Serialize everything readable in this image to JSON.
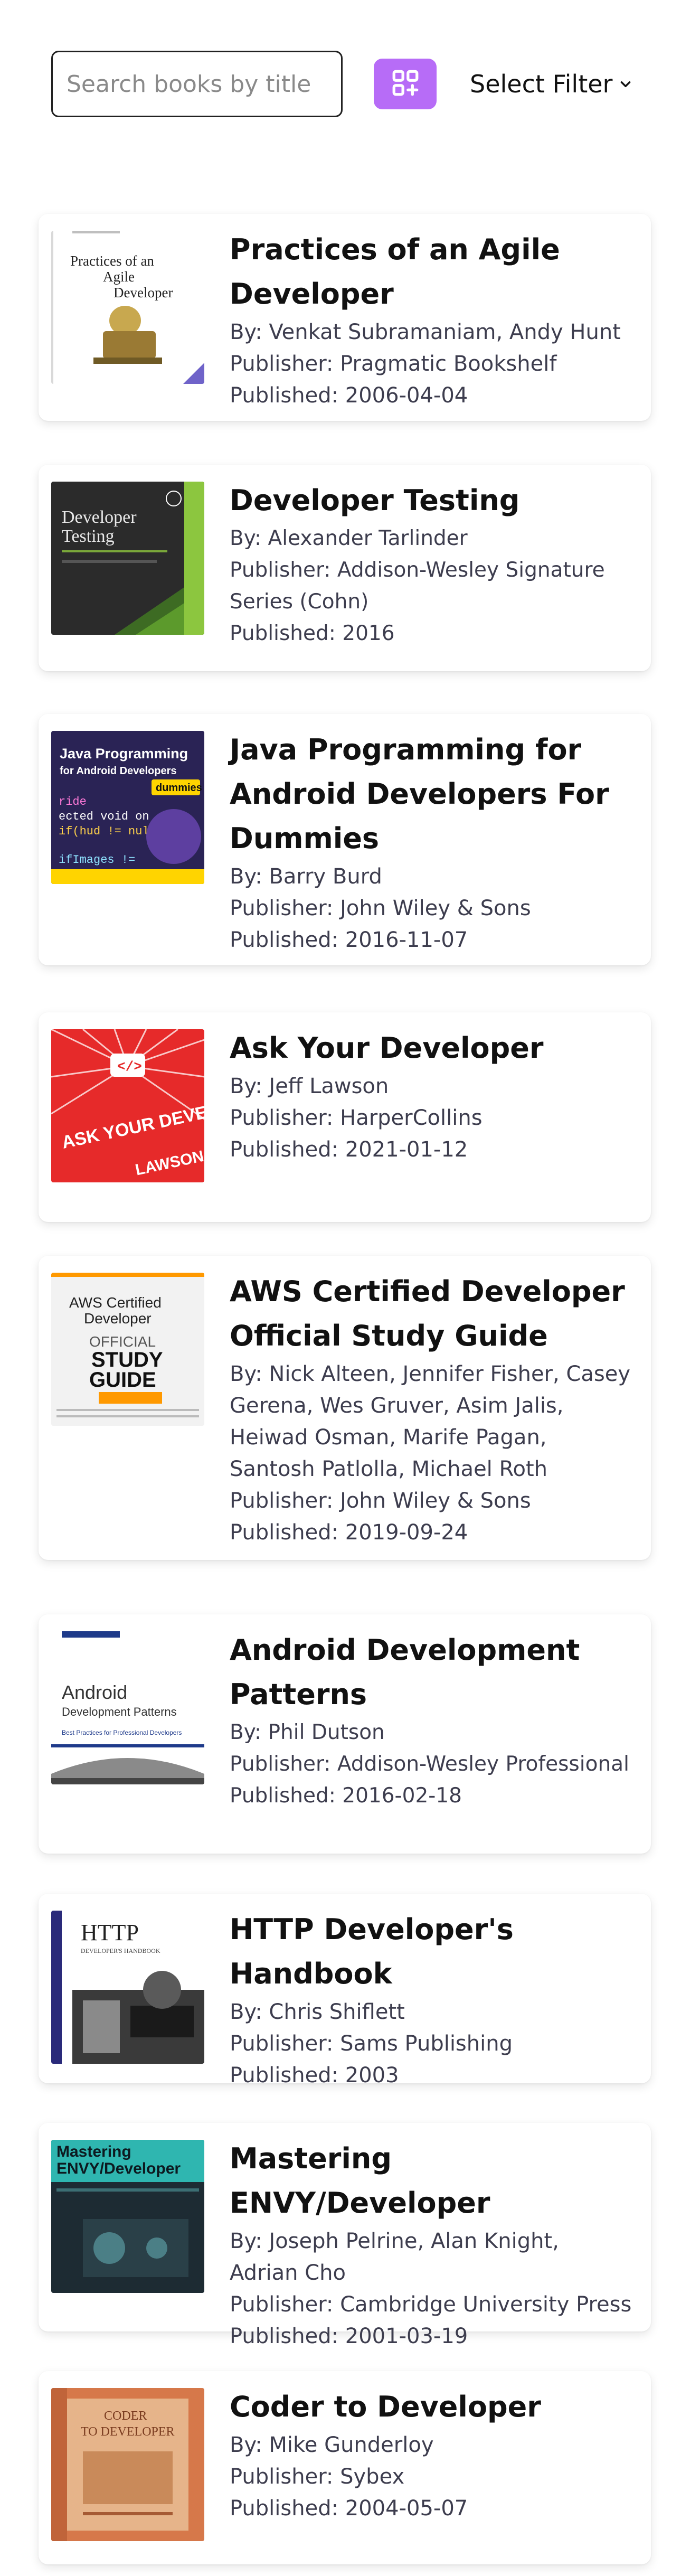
{
  "search": {
    "placeholder": "Search books by title",
    "value": ""
  },
  "toolbar": {
    "view_toggle_icon": "grid-add-icon",
    "filter_label": "Select Filter",
    "accent_color": "#b76cf7"
  },
  "books": [
    {
      "title": "Practices of an Agile Developer",
      "authors": "By: Venkat Subramaniam, Andy Hunt",
      "publisher": "Publisher: Pragmatic Bookshelf",
      "published": "Published: 2006-04-04",
      "cover": {
        "title_line1": "Practices of an",
        "title_line2": "Agile",
        "title_line3": "Developer"
      }
    },
    {
      "title": "Developer Testing",
      "authors": "By: Alexander Tarlinder",
      "publisher": "Publisher: Addison-Wesley Signature Series (Cohn)",
      "published": "Published: 2016",
      "cover": {
        "title_line1": "Developer",
        "title_line2": "Testing"
      }
    },
    {
      "title": "Java Programming for Android Developers For Dummies",
      "authors": "By: Barry Burd",
      "publisher": "Publisher: John Wiley & Sons",
      "published": "Published: 2016-11-07",
      "cover": {
        "title_line1": "Java Programming",
        "title_line2": "for Android Developers",
        "series": "dummies"
      }
    },
    {
      "title": "Ask Your Developer",
      "authors": "By: Jeff Lawson",
      "publisher": "Publisher: HarperCollins",
      "published": "Published: 2021-01-12",
      "cover": {
        "title_line1": "ASK YOUR DEVELOPER",
        "author": "LAWSON"
      }
    },
    {
      "title": "AWS Certified Developer Official Study Guide",
      "authors": "By: Nick Alteen, Jennifer Fisher, Casey Gerena, Wes Gruver, Asim Jalis, Heiwad Osman, Marife Pagan, Santosh Patlolla, Michael Roth",
      "publisher": "Publisher: John Wiley & Sons",
      "published": "Published: 2019-09-24",
      "cover": {
        "title_line1": "AWS Certified",
        "title_line2": "Developer",
        "title_line3": "OFFICIAL",
        "title_line4": "STUDY",
        "title_line5": "GUIDE"
      }
    },
    {
      "title": "Android Development Patterns",
      "authors": "By: Phil Dutson",
      "publisher": "Publisher: Addison-Wesley Professional",
      "published": "Published: 2016-02-18",
      "cover": {
        "title_line1": "Android",
        "title_line2": "Development Patterns",
        "subtitle": "Best Practices for Professional Developers"
      }
    },
    {
      "title": "HTTP Developer's Handbook",
      "authors": "By: Chris Shiflett",
      "publisher": "Publisher: Sams Publishing",
      "published": "Published: 2003",
      "cover": {
        "title_line1": "HTTP",
        "title_line2": "DEVELOPER'S HANDBOOK"
      }
    },
    {
      "title": "Mastering ENVY/Developer",
      "authors": "By: Joseph Pelrine, Alan Knight, Adrian Cho",
      "publisher": "Publisher: Cambridge University Press",
      "published": "Published: 2001-03-19",
      "cover": {
        "title_line1": "Mastering",
        "title_line2": "ENVY/Developer"
      }
    },
    {
      "title": "Coder to Developer",
      "authors": "By: Mike Gunderloy",
      "publisher": "Publisher: Sybex",
      "published": "Published: 2004-05-07",
      "cover": {
        "title_line1": "CODER",
        "title_line2": "TO DEVELOPER"
      }
    }
  ]
}
